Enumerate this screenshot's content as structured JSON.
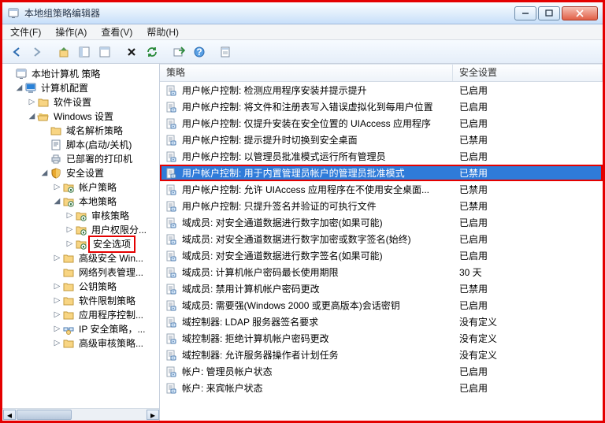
{
  "window": {
    "title": "本地组策略编辑器"
  },
  "menu": {
    "file": "文件(F)",
    "action": "操作(A)",
    "view": "查看(V)",
    "help": "帮助(H)"
  },
  "tree": [
    {
      "depth": 0,
      "toggle": "",
      "icon": "console",
      "label": "本地计算机 策略"
    },
    {
      "depth": 1,
      "toggle": "◢",
      "icon": "computer",
      "label": "计算机配置"
    },
    {
      "depth": 2,
      "toggle": "▷",
      "icon": "folder",
      "label": "软件设置"
    },
    {
      "depth": 2,
      "toggle": "◢",
      "icon": "folder-open",
      "label": "Windows 设置"
    },
    {
      "depth": 3,
      "toggle": "",
      "icon": "folder",
      "label": "域名解析策略"
    },
    {
      "depth": 3,
      "toggle": "",
      "icon": "script",
      "label": "脚本(启动/关机)"
    },
    {
      "depth": 3,
      "toggle": "",
      "icon": "printer",
      "label": "已部署的打印机"
    },
    {
      "depth": 3,
      "toggle": "◢",
      "icon": "shield",
      "label": "安全设置"
    },
    {
      "depth": 4,
      "toggle": "▷",
      "icon": "folder-sec",
      "label": "帐户策略"
    },
    {
      "depth": 4,
      "toggle": "◢",
      "icon": "folder-sec",
      "label": "本地策略"
    },
    {
      "depth": 5,
      "toggle": "▷",
      "icon": "folder-sec",
      "label": "审核策略"
    },
    {
      "depth": 5,
      "toggle": "▷",
      "icon": "folder-sec",
      "label": "用户权限分..."
    },
    {
      "depth": 5,
      "toggle": "▷",
      "icon": "folder-sec",
      "label": "安全选项",
      "highlight": true
    },
    {
      "depth": 4,
      "toggle": "▷",
      "icon": "folder",
      "label": "高级安全 Win..."
    },
    {
      "depth": 4,
      "toggle": "",
      "icon": "folder",
      "label": "网络列表管理..."
    },
    {
      "depth": 4,
      "toggle": "▷",
      "icon": "folder",
      "label": "公钥策略"
    },
    {
      "depth": 4,
      "toggle": "▷",
      "icon": "folder",
      "label": "软件限制策略"
    },
    {
      "depth": 4,
      "toggle": "▷",
      "icon": "folder",
      "label": "应用程序控制..."
    },
    {
      "depth": 4,
      "toggle": "▷",
      "icon": "ipsec",
      "label": "IP 安全策略，..."
    },
    {
      "depth": 4,
      "toggle": "▷",
      "icon": "folder",
      "label": "高级审核策略..."
    }
  ],
  "columns": {
    "policy": "策略",
    "setting": "安全设置"
  },
  "rows": [
    {
      "policy": "用户帐户控制: 检测应用程序安装并提示提升",
      "setting": "已启用"
    },
    {
      "policy": "用户帐户控制: 将文件和注册表写入错误虚拟化到每用户位置",
      "setting": "已启用"
    },
    {
      "policy": "用户帐户控制: 仅提升安装在安全位置的 UIAccess 应用程序",
      "setting": "已启用"
    },
    {
      "policy": "用户帐户控制: 提示提升时切换到安全桌面",
      "setting": "已禁用"
    },
    {
      "policy": "用户帐户控制: 以管理员批准模式运行所有管理员",
      "setting": "已启用"
    },
    {
      "policy": "用户帐户控制: 用于内置管理员帐户的管理员批准模式",
      "setting": "已禁用",
      "highlight": true,
      "selected": true
    },
    {
      "policy": "用户帐户控制: 允许 UIAccess 应用程序在不使用安全桌面...",
      "setting": "已禁用"
    },
    {
      "policy": "用户帐户控制: 只提升签名并验证的可执行文件",
      "setting": "已禁用"
    },
    {
      "policy": "域成员: 对安全通道数据进行数字加密(如果可能)",
      "setting": "已启用"
    },
    {
      "policy": "域成员: 对安全通道数据进行数字加密或数字签名(始终)",
      "setting": "已启用"
    },
    {
      "policy": "域成员: 对安全通道数据进行数字签名(如果可能)",
      "setting": "已启用"
    },
    {
      "policy": "域成员: 计算机帐户密码最长使用期限",
      "setting": "30 天"
    },
    {
      "policy": "域成员: 禁用计算机帐户密码更改",
      "setting": "已禁用"
    },
    {
      "policy": "域成员: 需要强(Windows 2000 或更高版本)会话密钥",
      "setting": "已启用"
    },
    {
      "policy": "域控制器: LDAP 服务器签名要求",
      "setting": "没有定义"
    },
    {
      "policy": "域控制器: 拒绝计算机帐户密码更改",
      "setting": "没有定义"
    },
    {
      "policy": "域控制器: 允许服务器操作者计划任务",
      "setting": "没有定义"
    },
    {
      "policy": "帐户: 管理员帐户状态",
      "setting": "已启用"
    },
    {
      "policy": "帐户: 来宾帐户状态",
      "setting": "已启用"
    }
  ]
}
